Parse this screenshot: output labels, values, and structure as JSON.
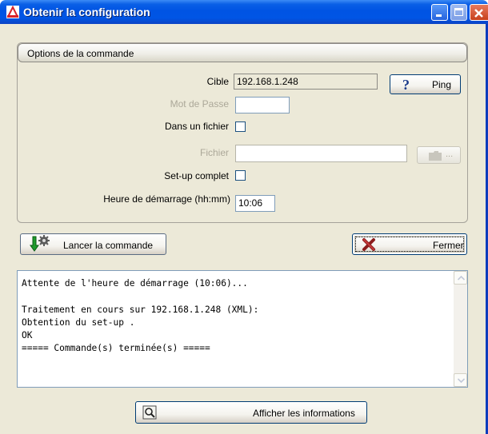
{
  "window": {
    "title": "Obtenir la configuration"
  },
  "group": {
    "title": "Options de la commande"
  },
  "form": {
    "cible_label": "Cible",
    "cible_value": "192.168.1.248",
    "ping_label": "Ping",
    "password_label": "Mot de Passe",
    "password_value": "",
    "file_check_label": "Dans un fichier",
    "file_label": "Fichier",
    "file_value": "",
    "browse_label": "...",
    "setup_label": "Set-up complet",
    "start_time_label": "Heure de démarrage (hh:mm)",
    "start_time_value": "10:06"
  },
  "buttons": {
    "run_label": "Lancer la commande",
    "close_label": "Fermer",
    "info_label": "Afficher les informations"
  },
  "log": {
    "text": "Attente de l'heure de démarrage (10:06)...\n\nTraitement en cours sur 192.168.1.248 (XML):\nObtention du set-up .\nOK\n===== Commande(s) terminée(s) ====="
  },
  "icons": [
    "app-icon",
    "minimize-icon",
    "maximize-icon",
    "close-icon",
    "help-icon",
    "folder-icon",
    "run-command-icon",
    "cancel-x-icon",
    "magnifier-icon",
    "scroll-up-icon",
    "scroll-down-icon"
  ],
  "colors": {
    "titlebar": "#0054e3",
    "dialog_bg": "#ece9d8",
    "close_button": "#c7401c",
    "frame_border": "#0d3cbd"
  }
}
